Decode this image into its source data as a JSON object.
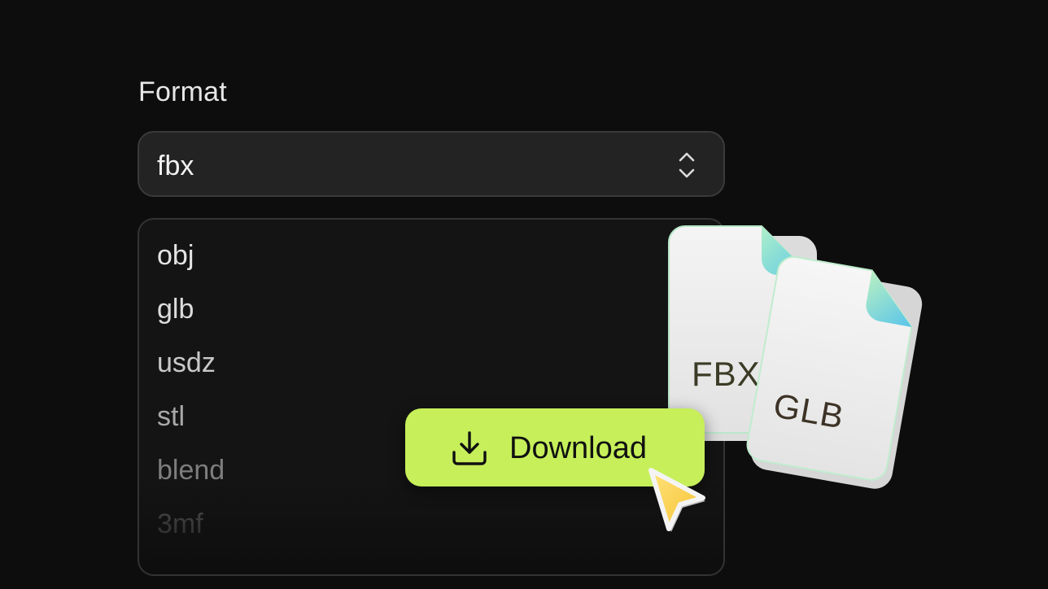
{
  "format": {
    "label": "Format",
    "selected": "fbx",
    "options": [
      {
        "label": "obj",
        "color": "#e4e4e4"
      },
      {
        "label": "glb",
        "color": "#dcdcdc"
      },
      {
        "label": "usdz",
        "color": "#c9c9c9"
      },
      {
        "label": "stl",
        "color": "#a8a8a8"
      },
      {
        "label": "blend",
        "color": "#7e7e7e"
      },
      {
        "label": "3mf",
        "color": "#5a5a5a"
      }
    ]
  },
  "download": {
    "label": "Download",
    "accent": "#c6ef5a"
  },
  "files": [
    {
      "label": "FBX",
      "icon": "file-icon"
    },
    {
      "label": "GLB",
      "icon": "file-icon"
    }
  ],
  "icons": {
    "select": "chevron-updown-icon",
    "download": "download-icon",
    "cursor": "cursor-icon"
  }
}
